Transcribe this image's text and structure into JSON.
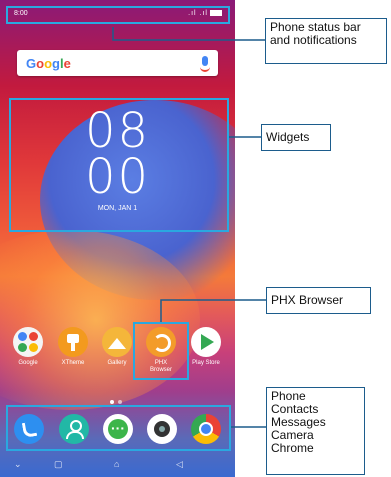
{
  "status_bar": {
    "time": "8:00",
    "signal_text": ".ıl .ıl"
  },
  "search": {
    "logo": "Google"
  },
  "clock": {
    "hours": "08",
    "minutes": "00",
    "date": "MON, JAN 1"
  },
  "home_apps": [
    {
      "label": "Google"
    },
    {
      "label": "XTheme"
    },
    {
      "label": "Gallery"
    },
    {
      "label": "PHX Browser"
    },
    {
      "label": "Play Store"
    }
  ],
  "dock": [
    "phone",
    "contacts",
    "messages",
    "camera",
    "chrome"
  ],
  "nav_buttons": [
    "back-chevron",
    "recents",
    "home",
    "back-triangle"
  ],
  "callouts": {
    "status": "Phone status bar and notifications",
    "widgets": "Widgets",
    "phx": "PHX Browser",
    "dock_lines": [
      "Phone",
      "Contacts",
      "Messages",
      "Camera",
      "Chrome"
    ]
  },
  "colors": {
    "highlight": "#2aa8e0",
    "callout_border": "#1c5c8c"
  }
}
